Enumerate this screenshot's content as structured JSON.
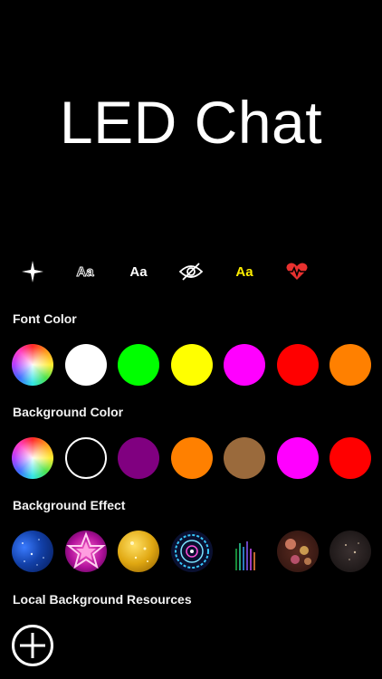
{
  "preview": {
    "text": "LED Chat",
    "text_color": "#ffffff",
    "background": "#000000"
  },
  "toolbar": {
    "tools": [
      {
        "icon": "sparkle-icon"
      },
      {
        "icon": "outline-text-icon",
        "label": "Aa"
      },
      {
        "icon": "bold-text-icon",
        "label": "Aa"
      },
      {
        "icon": "eye-slash-icon"
      },
      {
        "icon": "colored-text-icon",
        "label": "Aa",
        "colors": [
          "#ffee00",
          "#2d5cff"
        ]
      },
      {
        "icon": "heartbeat-icon",
        "color": "#e8312f"
      }
    ]
  },
  "font_color": {
    "label": "Font Color",
    "swatches": [
      "spectrum",
      "#ffffff",
      "#00ff00",
      "#ffff00",
      "#ff00ff",
      "#ff0000",
      "#ff8000"
    ]
  },
  "background_color": {
    "label": "Background Color",
    "swatches": [
      "spectrum",
      "none",
      "#800080",
      "#ff8000",
      "#9a6a3c",
      "#ff00ff",
      "#ff0000"
    ]
  },
  "background_effect": {
    "label": "Background Effect",
    "effects": [
      "blue-starfield-icon",
      "pink-star-icon",
      "golden-glitter-icon",
      "neon-mandala-icon",
      "aurora-lines-icon",
      "bokeh-lights-icon",
      "dark-sparkle-icon"
    ]
  },
  "local_resources": {
    "label": "Local Background Resources",
    "add_icon": "plus-circle-icon"
  }
}
